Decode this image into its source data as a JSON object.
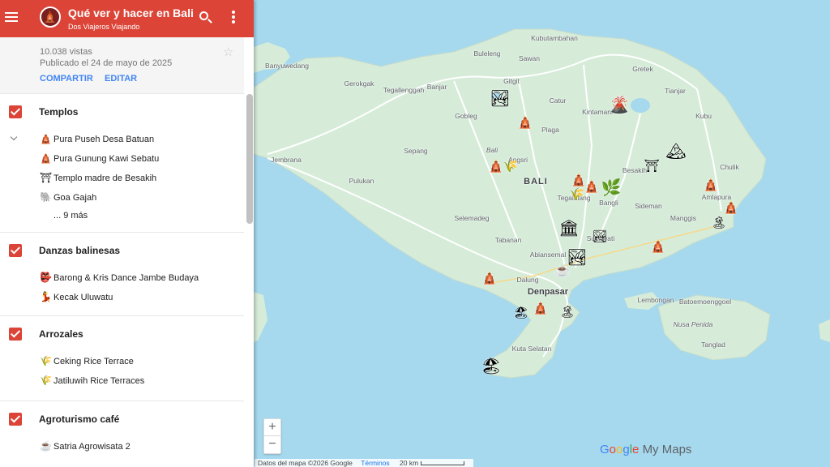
{
  "header": {
    "title": "Qué ver y hacer en Bali",
    "author": "Dos Viajeros Viajando"
  },
  "info": {
    "views": "10.038 vistas",
    "published": "Publicado el 24 de mayo de 2025",
    "share_label": "COMPARTIR",
    "edit_label": "EDITAR"
  },
  "layers": [
    {
      "title": "Templos",
      "items": [
        {
          "label": "Pura Puseh Desa Batuan",
          "icon": "temple-icon"
        },
        {
          "label": "Pura Gunung Kawi Sebatu",
          "icon": "temple-icon"
        },
        {
          "label": "Templo madre de Besakih",
          "icon": "temple-gate-icon"
        },
        {
          "label": "Goa Gajah",
          "icon": "elephant-icon"
        }
      ],
      "more": "... 9 más"
    },
    {
      "title": "Danzas balinesas",
      "items": [
        {
          "label": "Barong & Kris Dance Jambe Budaya",
          "icon": "barong-mask-icon"
        },
        {
          "label": "Kecak Uluwatu",
          "icon": "dancer-icon"
        }
      ]
    },
    {
      "title": "Arrozales",
      "items": [
        {
          "label": "Ceking Rice Terrace",
          "icon": "rice-terrace-icon"
        },
        {
          "label": "Jatiluwih Rice Terraces",
          "icon": "rice-terrace-icon"
        }
      ]
    },
    {
      "title": "Agroturismo café",
      "items": [
        {
          "label": "Satria Agrowisata 2",
          "icon": "coffee-cup-icon"
        }
      ]
    }
  ],
  "map": {
    "places": {
      "kubutambahan": "Kubutambahan",
      "buleleng": "Buleleng",
      "sawan": "Sawan",
      "banjarwedang": "Banyuwedang",
      "gretek": "Gretek",
      "gerokgak": "Gerokgak",
      "tegallenggah": "Tegallenggah",
      "banjar": "Banjar",
      "gitgit": "Gitgit",
      "catur": "Catur",
      "kintamani": "Kintamani",
      "tianjar": "Tianjar",
      "gobleg": "Gobleg",
      "plaga": "Plaga",
      "kubu": "Kubu",
      "sepang": "Sepang",
      "bali_small": "Bali",
      "angsri": "Angsri",
      "besakih": "Besakih",
      "chulik": "Chulik",
      "jembrana": "Jembrana",
      "bali_region": "BALI",
      "pulukan": "Pulukan",
      "tegalalang": "Tegalalang",
      "bangli": "Bangli",
      "amlapura": "Amlapura",
      "selemadeg": "Selemadeg",
      "sideman": "Sideman",
      "manggis": "Manggis",
      "tabanan": "Tabanan",
      "sukawati": "Sukawati",
      "abiansemal": "Abiansemal",
      "dalung": "Dalung",
      "denpasar": "Denpasar",
      "lembongan": "Lembongan",
      "batumounggoel": "Batoemoenggoel",
      "nusa_penida": "Nusa Penida",
      "kuta_selatan": "Kuta Selatan",
      "tanglad": "Tanglad"
    },
    "zoom_in": "+",
    "zoom_out": "−",
    "brand_suffix": "My Maps",
    "footer": {
      "data": "Datos del mapa ©2026 Google",
      "terms": "Términos",
      "scale": "20 km"
    }
  }
}
